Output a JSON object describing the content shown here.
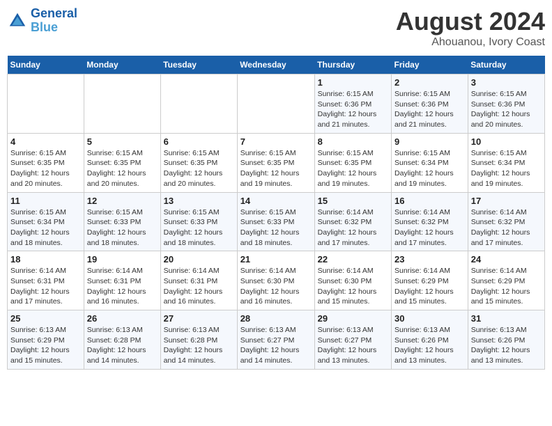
{
  "header": {
    "logo_line1": "General",
    "logo_line2": "Blue",
    "title": "August 2024",
    "subtitle": "Ahouanou, Ivory Coast"
  },
  "weekdays": [
    "Sunday",
    "Monday",
    "Tuesday",
    "Wednesday",
    "Thursday",
    "Friday",
    "Saturday"
  ],
  "weeks": [
    [
      {
        "day": "",
        "info": ""
      },
      {
        "day": "",
        "info": ""
      },
      {
        "day": "",
        "info": ""
      },
      {
        "day": "",
        "info": ""
      },
      {
        "day": "1",
        "info": "Sunrise: 6:15 AM\nSunset: 6:36 PM\nDaylight: 12 hours\nand 21 minutes."
      },
      {
        "day": "2",
        "info": "Sunrise: 6:15 AM\nSunset: 6:36 PM\nDaylight: 12 hours\nand 21 minutes."
      },
      {
        "day": "3",
        "info": "Sunrise: 6:15 AM\nSunset: 6:36 PM\nDaylight: 12 hours\nand 20 minutes."
      }
    ],
    [
      {
        "day": "4",
        "info": "Sunrise: 6:15 AM\nSunset: 6:35 PM\nDaylight: 12 hours\nand 20 minutes."
      },
      {
        "day": "5",
        "info": "Sunrise: 6:15 AM\nSunset: 6:35 PM\nDaylight: 12 hours\nand 20 minutes."
      },
      {
        "day": "6",
        "info": "Sunrise: 6:15 AM\nSunset: 6:35 PM\nDaylight: 12 hours\nand 20 minutes."
      },
      {
        "day": "7",
        "info": "Sunrise: 6:15 AM\nSunset: 6:35 PM\nDaylight: 12 hours\nand 19 minutes."
      },
      {
        "day": "8",
        "info": "Sunrise: 6:15 AM\nSunset: 6:35 PM\nDaylight: 12 hours\nand 19 minutes."
      },
      {
        "day": "9",
        "info": "Sunrise: 6:15 AM\nSunset: 6:34 PM\nDaylight: 12 hours\nand 19 minutes."
      },
      {
        "day": "10",
        "info": "Sunrise: 6:15 AM\nSunset: 6:34 PM\nDaylight: 12 hours\nand 19 minutes."
      }
    ],
    [
      {
        "day": "11",
        "info": "Sunrise: 6:15 AM\nSunset: 6:34 PM\nDaylight: 12 hours\nand 18 minutes."
      },
      {
        "day": "12",
        "info": "Sunrise: 6:15 AM\nSunset: 6:33 PM\nDaylight: 12 hours\nand 18 minutes."
      },
      {
        "day": "13",
        "info": "Sunrise: 6:15 AM\nSunset: 6:33 PM\nDaylight: 12 hours\nand 18 minutes."
      },
      {
        "day": "14",
        "info": "Sunrise: 6:15 AM\nSunset: 6:33 PM\nDaylight: 12 hours\nand 18 minutes."
      },
      {
        "day": "15",
        "info": "Sunrise: 6:14 AM\nSunset: 6:32 PM\nDaylight: 12 hours\nand 17 minutes."
      },
      {
        "day": "16",
        "info": "Sunrise: 6:14 AM\nSunset: 6:32 PM\nDaylight: 12 hours\nand 17 minutes."
      },
      {
        "day": "17",
        "info": "Sunrise: 6:14 AM\nSunset: 6:32 PM\nDaylight: 12 hours\nand 17 minutes."
      }
    ],
    [
      {
        "day": "18",
        "info": "Sunrise: 6:14 AM\nSunset: 6:31 PM\nDaylight: 12 hours\nand 17 minutes."
      },
      {
        "day": "19",
        "info": "Sunrise: 6:14 AM\nSunset: 6:31 PM\nDaylight: 12 hours\nand 16 minutes."
      },
      {
        "day": "20",
        "info": "Sunrise: 6:14 AM\nSunset: 6:31 PM\nDaylight: 12 hours\nand 16 minutes."
      },
      {
        "day": "21",
        "info": "Sunrise: 6:14 AM\nSunset: 6:30 PM\nDaylight: 12 hours\nand 16 minutes."
      },
      {
        "day": "22",
        "info": "Sunrise: 6:14 AM\nSunset: 6:30 PM\nDaylight: 12 hours\nand 15 minutes."
      },
      {
        "day": "23",
        "info": "Sunrise: 6:14 AM\nSunset: 6:29 PM\nDaylight: 12 hours\nand 15 minutes."
      },
      {
        "day": "24",
        "info": "Sunrise: 6:14 AM\nSunset: 6:29 PM\nDaylight: 12 hours\nand 15 minutes."
      }
    ],
    [
      {
        "day": "25",
        "info": "Sunrise: 6:13 AM\nSunset: 6:29 PM\nDaylight: 12 hours\nand 15 minutes."
      },
      {
        "day": "26",
        "info": "Sunrise: 6:13 AM\nSunset: 6:28 PM\nDaylight: 12 hours\nand 14 minutes."
      },
      {
        "day": "27",
        "info": "Sunrise: 6:13 AM\nSunset: 6:28 PM\nDaylight: 12 hours\nand 14 minutes."
      },
      {
        "day": "28",
        "info": "Sunrise: 6:13 AM\nSunset: 6:27 PM\nDaylight: 12 hours\nand 14 minutes."
      },
      {
        "day": "29",
        "info": "Sunrise: 6:13 AM\nSunset: 6:27 PM\nDaylight: 12 hours\nand 13 minutes."
      },
      {
        "day": "30",
        "info": "Sunrise: 6:13 AM\nSunset: 6:26 PM\nDaylight: 12 hours\nand 13 minutes."
      },
      {
        "day": "31",
        "info": "Sunrise: 6:13 AM\nSunset: 6:26 PM\nDaylight: 12 hours\nand 13 minutes."
      }
    ]
  ]
}
